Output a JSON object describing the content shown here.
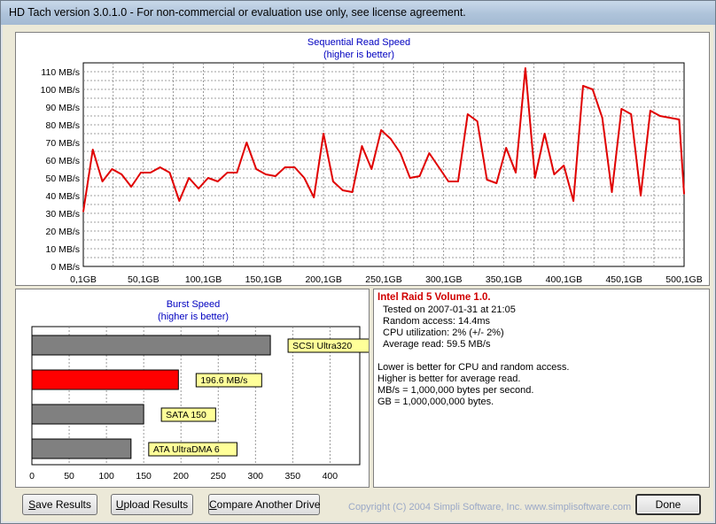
{
  "window": {
    "title": "HD Tach version 3.0.1.0  - For non-commercial or evaluation use only, see license agreement."
  },
  "read_chart": {
    "title": "Sequential Read Speed",
    "subtitle": "(higher is better)",
    "y_ticks": [
      "0 MB/s",
      "10 MB/s",
      "20 MB/s",
      "30 MB/s",
      "40 MB/s",
      "50 MB/s",
      "60 MB/s",
      "70 MB/s",
      "80 MB/s",
      "90 MB/s",
      "100 MB/s",
      "110 MB/s"
    ],
    "x_ticks": [
      "0,1GB",
      "50,1GB",
      "100,1GB",
      "150,1GB",
      "200,1GB",
      "250,1GB",
      "300,1GB",
      "350,1GB",
      "400,1GB",
      "450,1GB",
      "500,1GB"
    ],
    "color": "#e00000"
  },
  "burst_chart": {
    "title": "Burst Speed",
    "subtitle": "(higher is better)",
    "x_ticks": [
      "0",
      "50",
      "100",
      "150",
      "200",
      "250",
      "300",
      "350",
      "400"
    ]
  },
  "chart_data": [
    {
      "type": "line",
      "title": "Sequential Read Speed",
      "subtitle": "(higher is better)",
      "xlabel": "",
      "ylabel": "",
      "xunit": "GB",
      "yunit": "MB/s",
      "xlim": [
        0.1,
        500.1
      ],
      "ylim": [
        0,
        115
      ],
      "grid": true,
      "x": [
        0.1,
        8,
        16,
        24,
        32,
        40,
        48,
        56,
        64,
        72,
        80,
        88,
        96,
        104,
        112,
        120,
        128,
        136,
        144,
        152,
        160,
        168,
        176,
        184,
        192,
        200,
        208,
        216,
        224,
        232,
        240,
        248,
        256,
        264,
        272,
        280,
        288,
        296,
        304,
        312,
        320,
        328,
        336,
        344,
        352,
        360,
        368,
        376,
        384,
        392,
        400,
        408,
        416,
        424,
        432,
        440,
        448,
        456,
        464,
        472,
        480,
        488,
        496,
        500.1
      ],
      "values": [
        31,
        66,
        48,
        55,
        52,
        45,
        53,
        53,
        56,
        53,
        37,
        50,
        44,
        50,
        48,
        53,
        53,
        70,
        55,
        52,
        51,
        56,
        56,
        50,
        39,
        75,
        48,
        43,
        42,
        68,
        55,
        77,
        72,
        64,
        50,
        51,
        64,
        56,
        48,
        48,
        86,
        82,
        49,
        47,
        67,
        53,
        112,
        50,
        75,
        52,
        57,
        37,
        102,
        100,
        84,
        42,
        89,
        86,
        40,
        88,
        85,
        84,
        83,
        41
      ],
      "series": [
        {
          "name": "Intel Raid 5 Volume 1.0.",
          "color": "#e00000"
        }
      ]
    },
    {
      "type": "bar",
      "title": "Burst Speed",
      "subtitle": "(higher is better)",
      "orientation": "horizontal",
      "xlim": [
        0,
        440
      ],
      "grid": true,
      "categories": [
        "SCSI Ultra320",
        "196.6 MB/s",
        "SATA 150",
        "ATA UltraDMA 6"
      ],
      "values": [
        320,
        196.6,
        150,
        133
      ],
      "colors": [
        "#808080",
        "#ff0000",
        "#808080",
        "#808080"
      ]
    }
  ],
  "results": {
    "drive_name": "Intel Raid 5 Volume 1.0.",
    "tested_on": "Tested on 2007-01-31 at 21:05",
    "random_access": "Random access: 14.4ms",
    "cpu_utilization": "CPU utilization: 2% (+/- 2%)",
    "average_read": "Average read: 59.5 MB/s",
    "notes": [
      "Lower is better for CPU and random access.",
      "Higher is better for average read.",
      "MB/s = 1,000,000 bytes per second.",
      "GB = 1,000,000,000 bytes."
    ]
  },
  "buttons": {
    "save_first": "S",
    "save_rest": "ave Results",
    "upload_first": "U",
    "upload_rest": "pload Results",
    "compare_first": "C",
    "compare_rest": "ompare Another Drive",
    "done": "Done"
  },
  "footer": {
    "copyright": "Copyright (C) 2004 Simpli Software, Inc. www.simplisoftware.com"
  }
}
